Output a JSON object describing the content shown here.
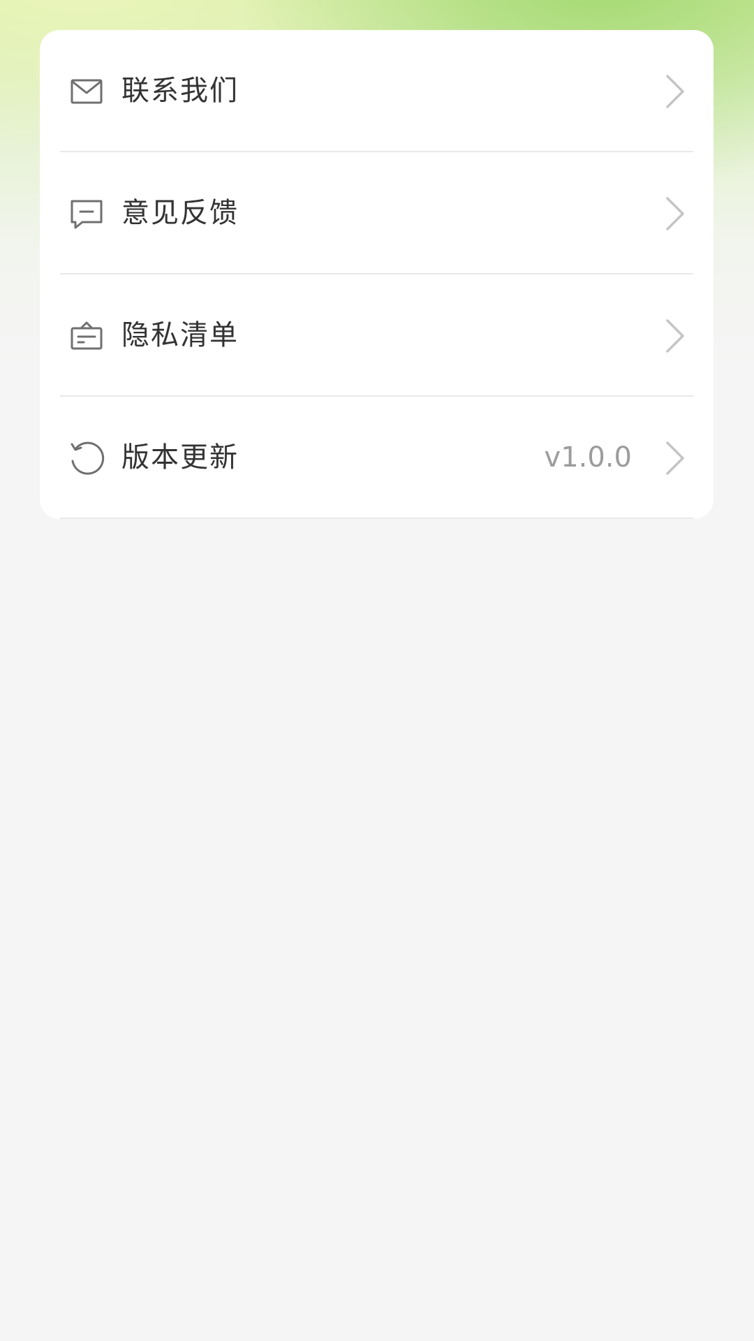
{
  "colors": {
    "accent_green": "#a6d870",
    "card_bg": "#ffffff",
    "page_bg": "#f5f5f5",
    "label_text": "#333333",
    "value_text": "#9c9c9c",
    "icon": "#6f6f6f",
    "chevron": "#c4c4c4"
  },
  "menu": {
    "items": [
      {
        "label": "联系我们",
        "icon": "mail-icon",
        "value": ""
      },
      {
        "label": "意见反馈",
        "icon": "feedback-icon",
        "value": ""
      },
      {
        "label": "隐私清单",
        "icon": "privacy-list-icon",
        "value": ""
      },
      {
        "label": "版本更新",
        "icon": "refresh-icon",
        "value": "v1.0.0"
      }
    ]
  }
}
